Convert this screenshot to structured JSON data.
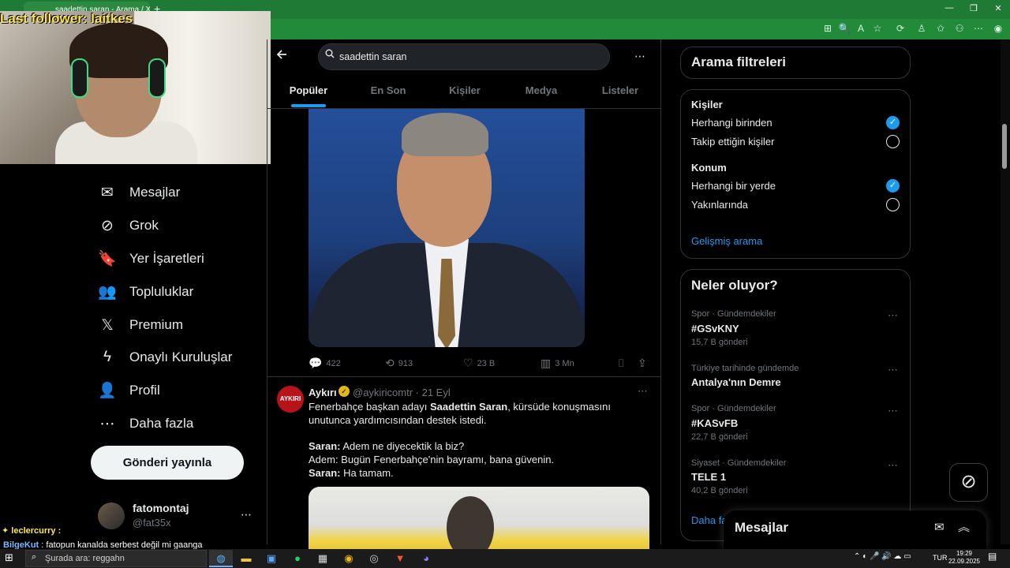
{
  "browser": {
    "tab_title": "saadettin saran - Arama / X",
    "new_tab": "+",
    "window_controls": [
      "—",
      "❐",
      "✕"
    ],
    "toolbar_icons": [
      "⊞",
      "🔍",
      "A",
      "☆",
      "⟳",
      "♙",
      "✩",
      "⚇",
      "⋯",
      "◉"
    ]
  },
  "stream": {
    "last_follower": "Last follower: laitkes"
  },
  "nav": {
    "items": [
      {
        "icon": "✉",
        "label": "Mesajlar"
      },
      {
        "icon": "⊘",
        "label": "Grok"
      },
      {
        "icon": "🔖",
        "label": "Yer İşaretleri"
      },
      {
        "icon": "👥",
        "label": "Topluluklar"
      },
      {
        "icon": "𝕏",
        "label": "Premium"
      },
      {
        "icon": "ϟ",
        "label": "Onaylı Kuruluşlar"
      },
      {
        "icon": "👤",
        "label": "Profil"
      },
      {
        "icon": "⋯",
        "label": "Daha fazla"
      }
    ],
    "post_button": "Gönderi yayınla",
    "account": {
      "name": "fatomontaj",
      "handle": "@fat35x",
      "more": "⋯"
    }
  },
  "search": {
    "value": "saadettin saran",
    "tabs": [
      "Popüler",
      "En Son",
      "Kişiler",
      "Medya",
      "Listeler"
    ],
    "active_tab": "Popüler"
  },
  "tweet1": {
    "replies": "422",
    "reposts": "913",
    "likes": "23 B",
    "views": "3 Mn"
  },
  "tweet2": {
    "avatar_text": "AYKIRI",
    "name": "Aykırı",
    "handle_date": "@aykiricomtr · 21 Eyl",
    "more": "⋯",
    "line1_pre": "Fenerbahçe başkan adayı ",
    "line1_bold": "Saadettin Saran",
    "line1_post": ", kürsüde konuşmasını",
    "line2": "unutunca yardımcısından destek istedi.",
    "line3_bold": "Saran:",
    "line3": " Adem ne diyecektik la biz?",
    "line4": "Adem: Bugün Fenerbahçe'nin bayramı, bana güvenin.",
    "line5_bold": "Saran:",
    "line5": " Ha tamam."
  },
  "filters": {
    "title": "Arama filtreleri",
    "people_label": "Kişiler",
    "people_opt1": "Herhangi birinden",
    "people_opt2": "Takip ettiğin kişiler",
    "location_label": "Konum",
    "loc_opt1": "Herhangi bir yerde",
    "loc_opt2": "Yakınlarında",
    "advanced": "Gelişmiş arama"
  },
  "trends": {
    "title": "Neler oluyor?",
    "items": [
      {
        "context": "Spor · Gündemdekiler",
        "name": "#GSvKNY",
        "count": "15,7 B gönderi"
      },
      {
        "context": "Türkiye tarihinde gündemde",
        "name": "Antalya'nın Demre",
        "count": ""
      },
      {
        "context": "Spor · Gündemdekiler",
        "name": "#KASvFB",
        "count": "22,7 B gönderi"
      },
      {
        "context": "Siyaset · Gündemdekiler",
        "name": "TELE 1",
        "count": "40,2 B gönderi"
      }
    ],
    "show_more": "Daha fa"
  },
  "messages_drawer": {
    "title": "Mesajlar"
  },
  "chat": {
    "line1": "✦ leclercurry :",
    "line2_user": "BilgeKut",
    "line2": " : fatopun kanalda serbest değil mi gaanga"
  },
  "taskbar": {
    "search_placeholder": "Şurada ara: reggahn",
    "language": "TUR",
    "time": "19:29",
    "date": "22.09.2025"
  },
  "colors": {
    "accent": "#1d9bf0",
    "browser_green": "#1e7a34",
    "background": "#000000"
  }
}
